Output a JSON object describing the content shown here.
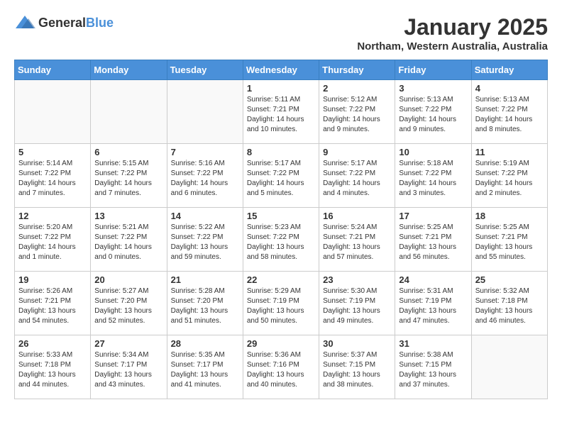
{
  "header": {
    "logo_general": "General",
    "logo_blue": "Blue",
    "month_title": "January 2025",
    "location": "Northam, Western Australia, Australia"
  },
  "weekdays": [
    "Sunday",
    "Monday",
    "Tuesday",
    "Wednesday",
    "Thursday",
    "Friday",
    "Saturday"
  ],
  "weeks": [
    [
      {
        "day": "",
        "empty": true
      },
      {
        "day": "",
        "empty": true
      },
      {
        "day": "",
        "empty": true
      },
      {
        "day": "1",
        "info": "Sunrise: 5:11 AM\nSunset: 7:21 PM\nDaylight: 14 hours\nand 10 minutes."
      },
      {
        "day": "2",
        "info": "Sunrise: 5:12 AM\nSunset: 7:22 PM\nDaylight: 14 hours\nand 9 minutes."
      },
      {
        "day": "3",
        "info": "Sunrise: 5:13 AM\nSunset: 7:22 PM\nDaylight: 14 hours\nand 9 minutes."
      },
      {
        "day": "4",
        "info": "Sunrise: 5:13 AM\nSunset: 7:22 PM\nDaylight: 14 hours\nand 8 minutes."
      }
    ],
    [
      {
        "day": "5",
        "info": "Sunrise: 5:14 AM\nSunset: 7:22 PM\nDaylight: 14 hours\nand 7 minutes."
      },
      {
        "day": "6",
        "info": "Sunrise: 5:15 AM\nSunset: 7:22 PM\nDaylight: 14 hours\nand 7 minutes."
      },
      {
        "day": "7",
        "info": "Sunrise: 5:16 AM\nSunset: 7:22 PM\nDaylight: 14 hours\nand 6 minutes."
      },
      {
        "day": "8",
        "info": "Sunrise: 5:17 AM\nSunset: 7:22 PM\nDaylight: 14 hours\nand 5 minutes."
      },
      {
        "day": "9",
        "info": "Sunrise: 5:17 AM\nSunset: 7:22 PM\nDaylight: 14 hours\nand 4 minutes."
      },
      {
        "day": "10",
        "info": "Sunrise: 5:18 AM\nSunset: 7:22 PM\nDaylight: 14 hours\nand 3 minutes."
      },
      {
        "day": "11",
        "info": "Sunrise: 5:19 AM\nSunset: 7:22 PM\nDaylight: 14 hours\nand 2 minutes."
      }
    ],
    [
      {
        "day": "12",
        "info": "Sunrise: 5:20 AM\nSunset: 7:22 PM\nDaylight: 14 hours\nand 1 minute."
      },
      {
        "day": "13",
        "info": "Sunrise: 5:21 AM\nSunset: 7:22 PM\nDaylight: 14 hours\nand 0 minutes."
      },
      {
        "day": "14",
        "info": "Sunrise: 5:22 AM\nSunset: 7:22 PM\nDaylight: 13 hours\nand 59 minutes."
      },
      {
        "day": "15",
        "info": "Sunrise: 5:23 AM\nSunset: 7:22 PM\nDaylight: 13 hours\nand 58 minutes."
      },
      {
        "day": "16",
        "info": "Sunrise: 5:24 AM\nSunset: 7:21 PM\nDaylight: 13 hours\nand 57 minutes."
      },
      {
        "day": "17",
        "info": "Sunrise: 5:25 AM\nSunset: 7:21 PM\nDaylight: 13 hours\nand 56 minutes."
      },
      {
        "day": "18",
        "info": "Sunrise: 5:25 AM\nSunset: 7:21 PM\nDaylight: 13 hours\nand 55 minutes."
      }
    ],
    [
      {
        "day": "19",
        "info": "Sunrise: 5:26 AM\nSunset: 7:21 PM\nDaylight: 13 hours\nand 54 minutes."
      },
      {
        "day": "20",
        "info": "Sunrise: 5:27 AM\nSunset: 7:20 PM\nDaylight: 13 hours\nand 52 minutes."
      },
      {
        "day": "21",
        "info": "Sunrise: 5:28 AM\nSunset: 7:20 PM\nDaylight: 13 hours\nand 51 minutes."
      },
      {
        "day": "22",
        "info": "Sunrise: 5:29 AM\nSunset: 7:19 PM\nDaylight: 13 hours\nand 50 minutes."
      },
      {
        "day": "23",
        "info": "Sunrise: 5:30 AM\nSunset: 7:19 PM\nDaylight: 13 hours\nand 49 minutes."
      },
      {
        "day": "24",
        "info": "Sunrise: 5:31 AM\nSunset: 7:19 PM\nDaylight: 13 hours\nand 47 minutes."
      },
      {
        "day": "25",
        "info": "Sunrise: 5:32 AM\nSunset: 7:18 PM\nDaylight: 13 hours\nand 46 minutes."
      }
    ],
    [
      {
        "day": "26",
        "info": "Sunrise: 5:33 AM\nSunset: 7:18 PM\nDaylight: 13 hours\nand 44 minutes."
      },
      {
        "day": "27",
        "info": "Sunrise: 5:34 AM\nSunset: 7:17 PM\nDaylight: 13 hours\nand 43 minutes."
      },
      {
        "day": "28",
        "info": "Sunrise: 5:35 AM\nSunset: 7:17 PM\nDaylight: 13 hours\nand 41 minutes."
      },
      {
        "day": "29",
        "info": "Sunrise: 5:36 AM\nSunset: 7:16 PM\nDaylight: 13 hours\nand 40 minutes."
      },
      {
        "day": "30",
        "info": "Sunrise: 5:37 AM\nSunset: 7:15 PM\nDaylight: 13 hours\nand 38 minutes."
      },
      {
        "day": "31",
        "info": "Sunrise: 5:38 AM\nSunset: 7:15 PM\nDaylight: 13 hours\nand 37 minutes."
      },
      {
        "day": "",
        "empty": true
      }
    ]
  ]
}
